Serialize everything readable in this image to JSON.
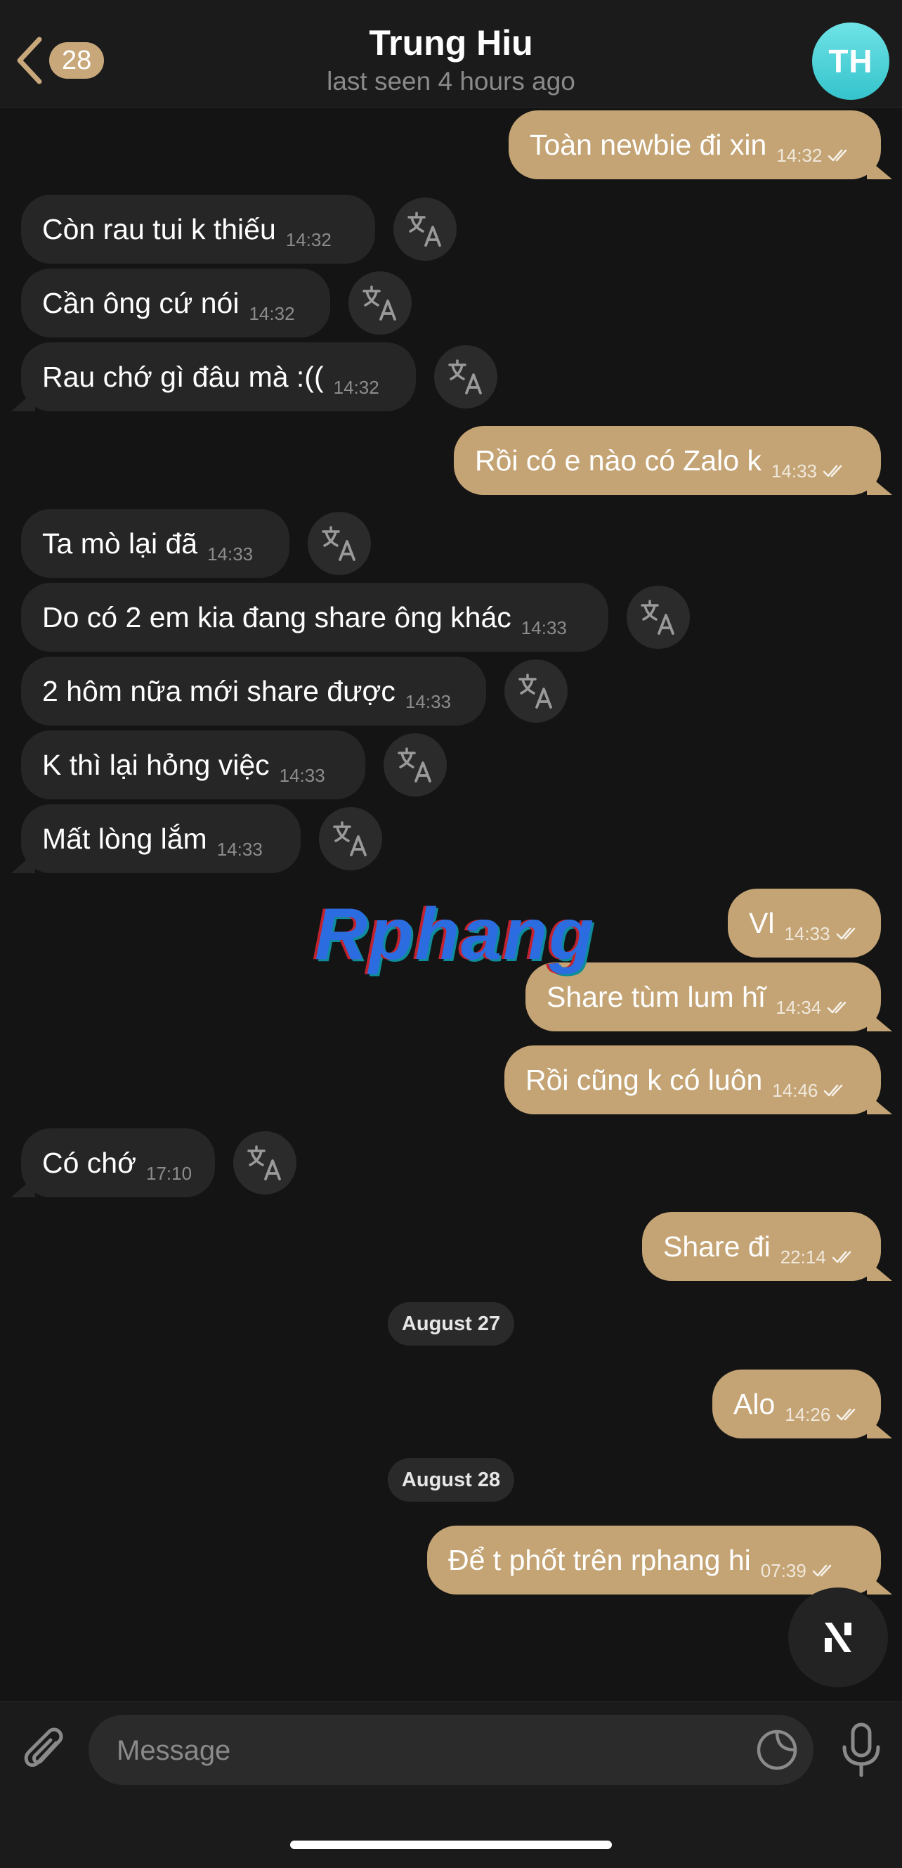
{
  "header": {
    "back_count": "28",
    "title": "Trung Hiu",
    "status": "last seen 4 hours ago",
    "avatar_initials": "TH"
  },
  "messages": [
    {
      "dir": "out",
      "text": "Toàn newbie đi xin",
      "time": "14:32"
    },
    {
      "dir": "in",
      "text": "Còn rau tui k thiếu",
      "time": "14:32"
    },
    {
      "dir": "in",
      "text": "Cần ông cứ nói",
      "time": "14:32"
    },
    {
      "dir": "in",
      "text": "Rau chớ gì đâu mà :((",
      "time": "14:32"
    },
    {
      "dir": "out",
      "text": "Rồi có e nào có Zalo k",
      "time": "14:33"
    },
    {
      "dir": "in",
      "text": "Ta mò lại đã",
      "time": "14:33"
    },
    {
      "dir": "in",
      "text": "Do có 2 em kia đang share ông khác",
      "time": "14:33"
    },
    {
      "dir": "in",
      "text": "2 hôm nữa mới share được",
      "time": "14:33"
    },
    {
      "dir": "in",
      "text": "K thì lại hỏng việc",
      "time": "14:33"
    },
    {
      "dir": "in",
      "text": "Mất lòng lắm",
      "time": "14:33"
    },
    {
      "dir": "out",
      "text": "Vl",
      "time": "14:33"
    },
    {
      "dir": "out",
      "text": "Share tùm lum hĩ",
      "time": "14:34"
    },
    {
      "dir": "out",
      "text": "Rồi cũng k có luôn",
      "time": "14:46"
    },
    {
      "dir": "in",
      "text": "Có chớ",
      "time": "17:10"
    },
    {
      "dir": "out",
      "text": "Share đi",
      "time": "22:14"
    },
    {
      "dir": "out",
      "text": "Alo",
      "time": "14:26"
    },
    {
      "dir": "out",
      "text": "Để t phốt trên rphang hi",
      "time": "07:39"
    }
  ],
  "dates": [
    "August 27",
    "August 28"
  ],
  "watermark": "Rphang",
  "composer": {
    "placeholder": "Message"
  },
  "colors": {
    "background": "#141414",
    "outgoing_bubble": "#c4a474",
    "incoming_bubble": "#262626",
    "accent": "#c8a87a",
    "avatar": "#4fd3d9"
  }
}
